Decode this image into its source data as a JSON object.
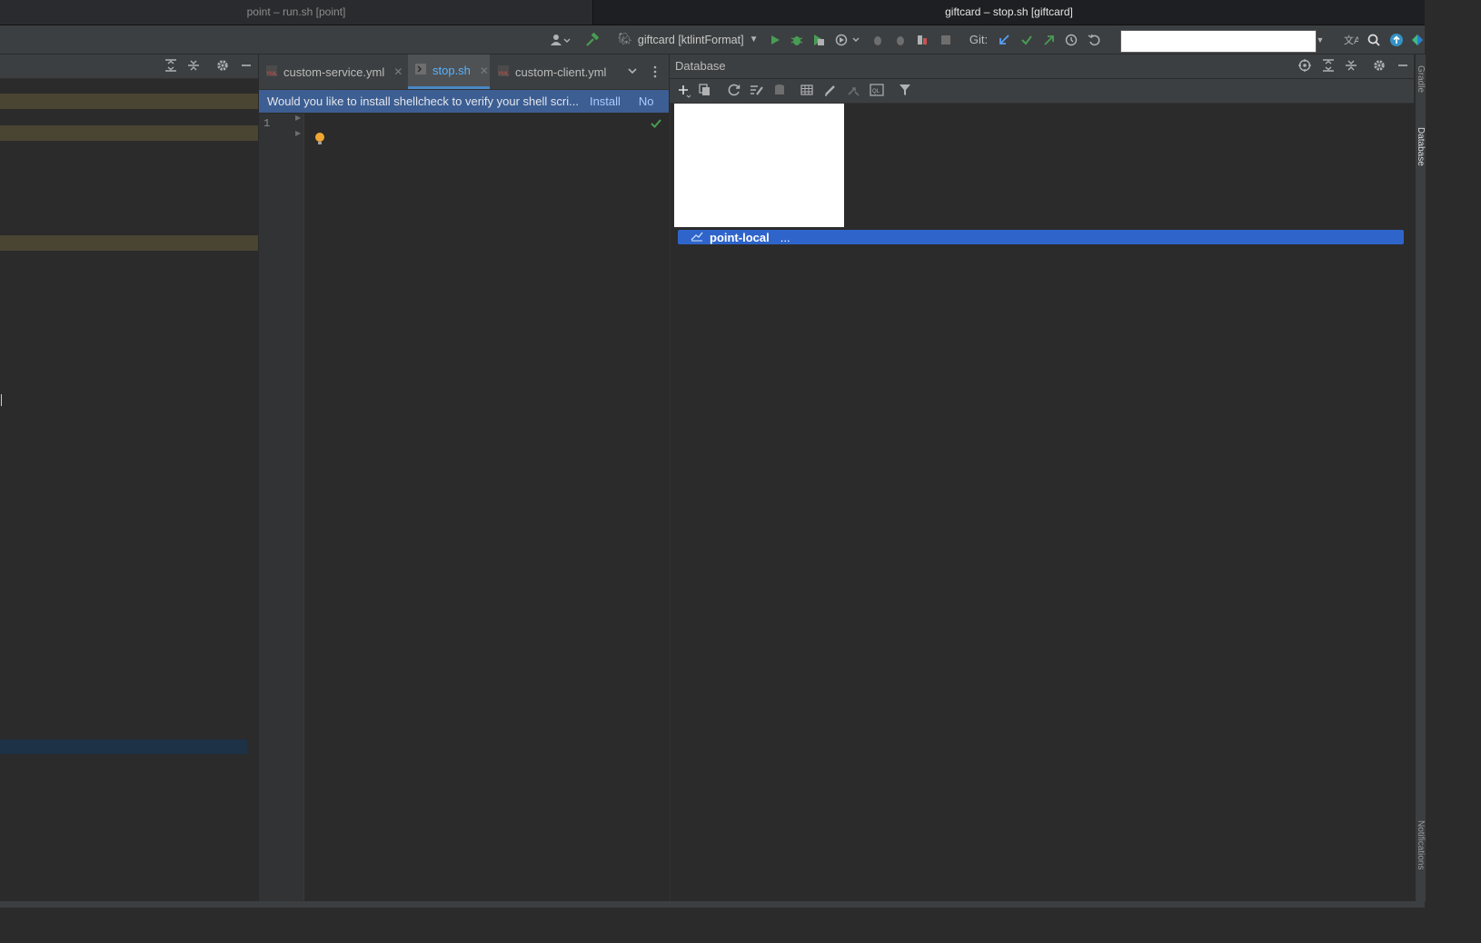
{
  "window_tabs": [
    {
      "label": "point – run.sh [point]",
      "active": false
    },
    {
      "label": "giftcard – stop.sh [giftcard]",
      "active": true
    }
  ],
  "toolbar": {
    "run_config": "giftcard [ktlintFormat]",
    "git_label": "Git:",
    "search_value": ""
  },
  "editor": {
    "tabs": [
      {
        "label": "custom-service.yml",
        "icon": "yaml-file-icon",
        "active": false
      },
      {
        "label": "stop.sh",
        "icon": "shell-script-icon",
        "active": true
      },
      {
        "label": "custom-client.yml",
        "icon": "yaml-file-icon",
        "active": false
      }
    ],
    "banner": {
      "message": "Would you like to install shellcheck to verify your shell scri...",
      "install_label": "Install",
      "no_label": "No"
    },
    "line_numbers": [
      "1"
    ]
  },
  "database": {
    "title": "Database",
    "tree": [
      {
        "label": "point-local",
        "suffix": "...",
        "selected": true
      }
    ]
  },
  "right_strip": {
    "labels": [
      "Gradle",
      "Database",
      "Notifications"
    ]
  },
  "colors": {
    "accent": "#2f65ca",
    "banner": "#3d5e92",
    "run_green": "#499c54",
    "link_blue": "#589df6"
  }
}
